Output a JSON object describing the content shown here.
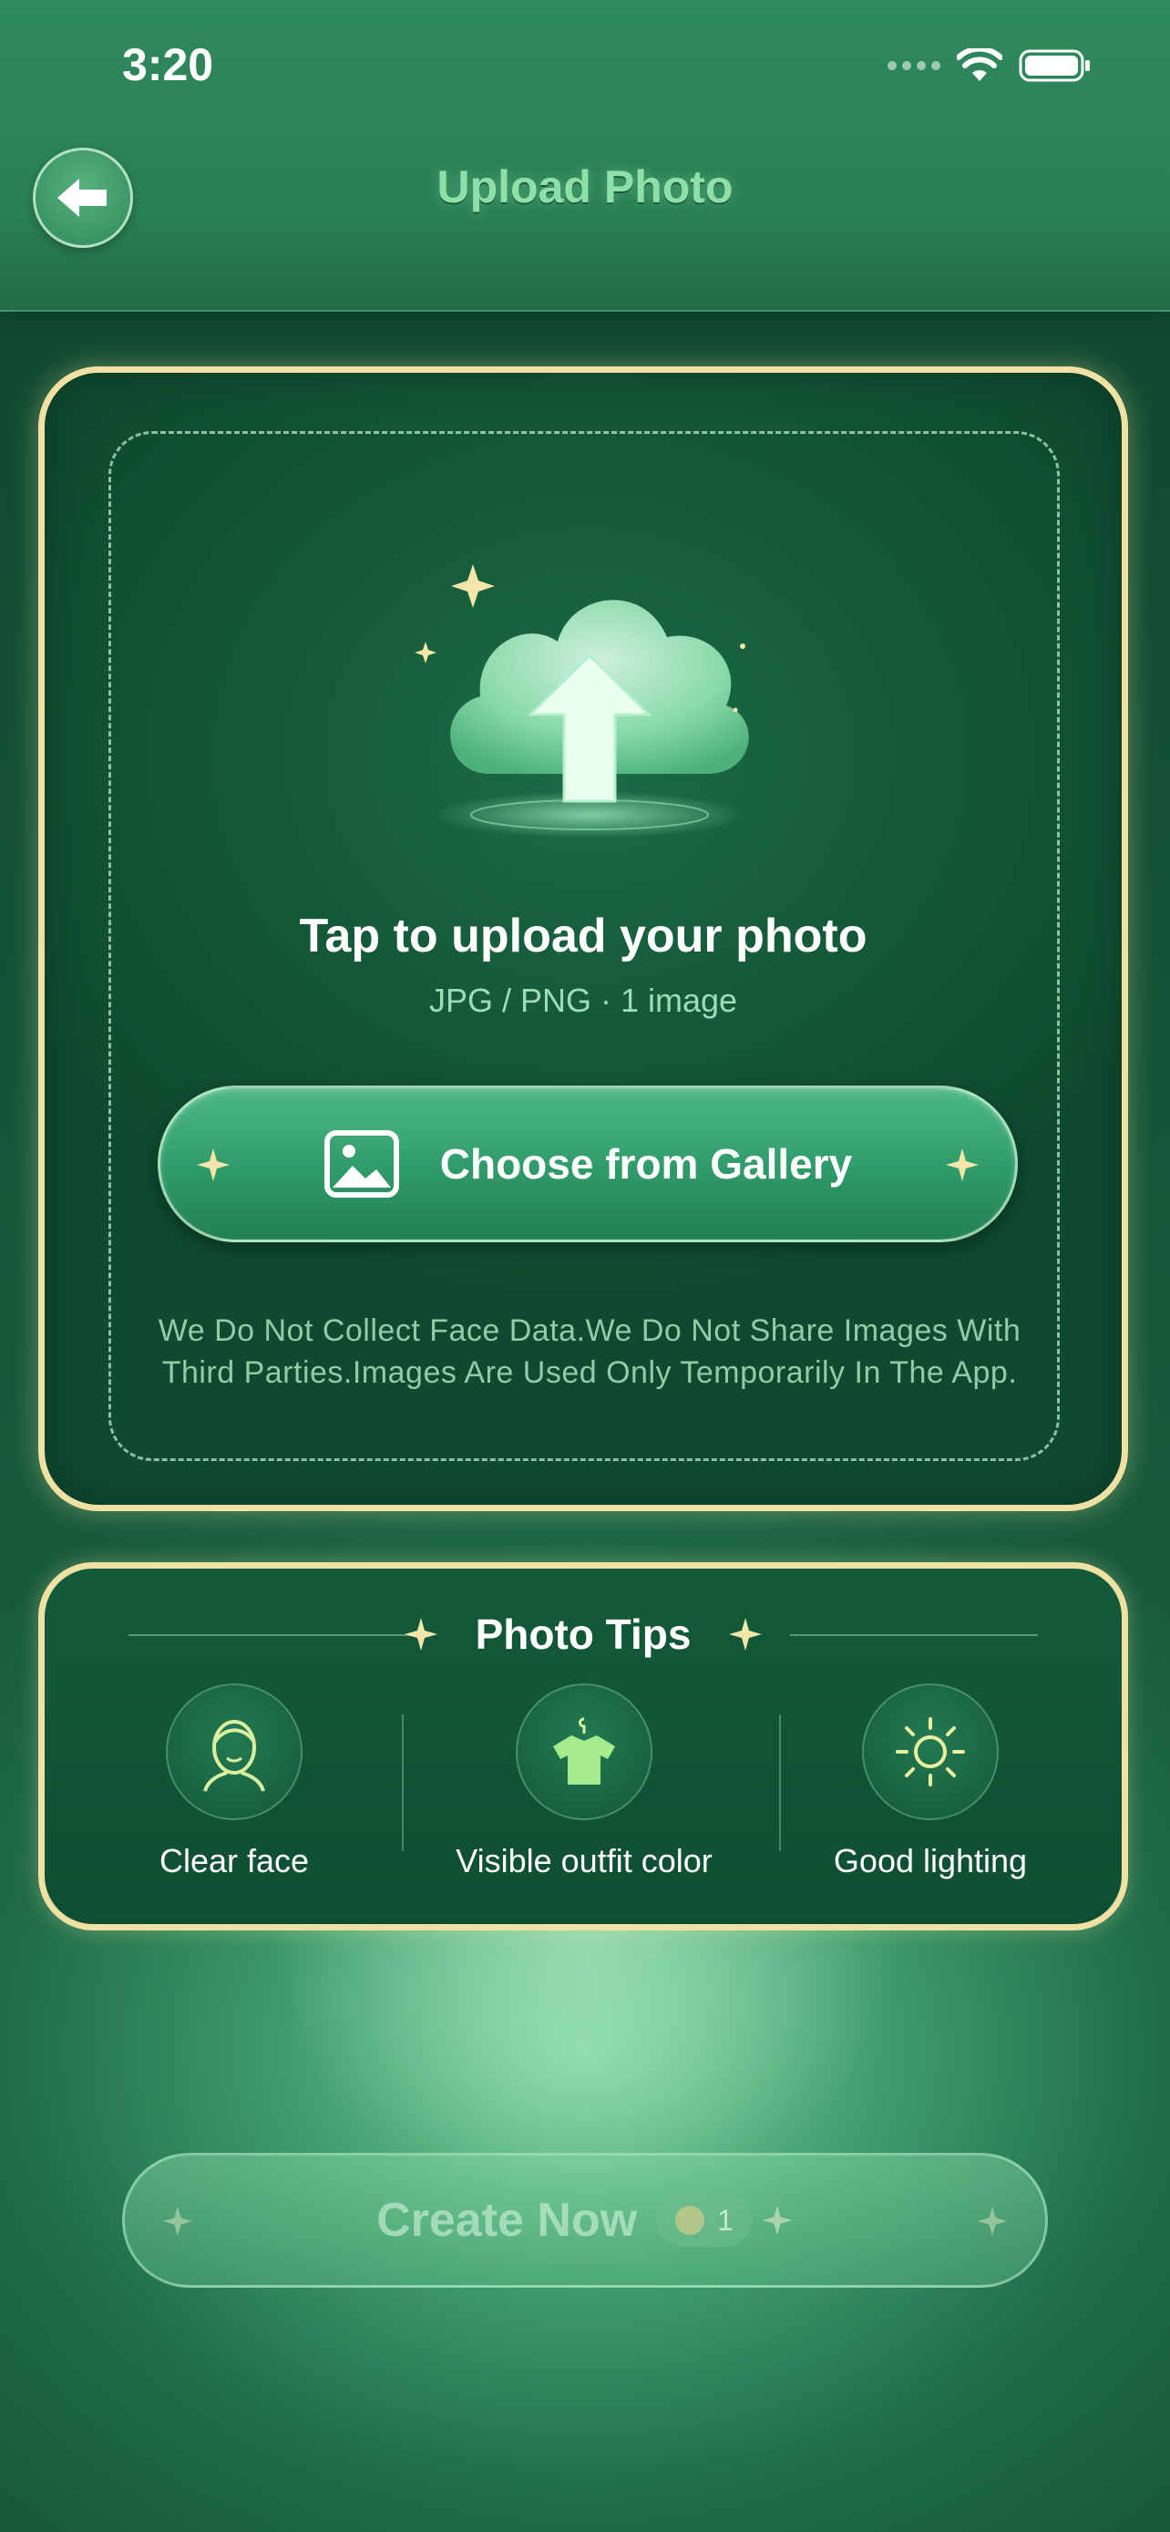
{
  "status_bar": {
    "time": "3:20"
  },
  "header": {
    "title": "Upload Photo"
  },
  "upload": {
    "title": "Tap to upload your photo",
    "subtitle": "JPG / PNG · 1 image",
    "gallery_button": "Choose from Gallery",
    "privacy_note": "We Do Not Collect Face Data.We Do Not Share Images With Third Parties.Images Are Used Only Temporarily In The App."
  },
  "tips": {
    "title": "Photo Tips",
    "items": [
      {
        "label": "Clear face",
        "icon": "face-icon"
      },
      {
        "label": "Visible outfit color",
        "icon": "shirt-icon"
      },
      {
        "label": "Good lighting",
        "icon": "sun-icon"
      }
    ]
  },
  "create": {
    "label": "Create Now",
    "cost": "1"
  },
  "colors": {
    "accent_gold": "#efe0a4",
    "brand_green": "#2f8a5c",
    "title_green": "#8fe0a8"
  }
}
